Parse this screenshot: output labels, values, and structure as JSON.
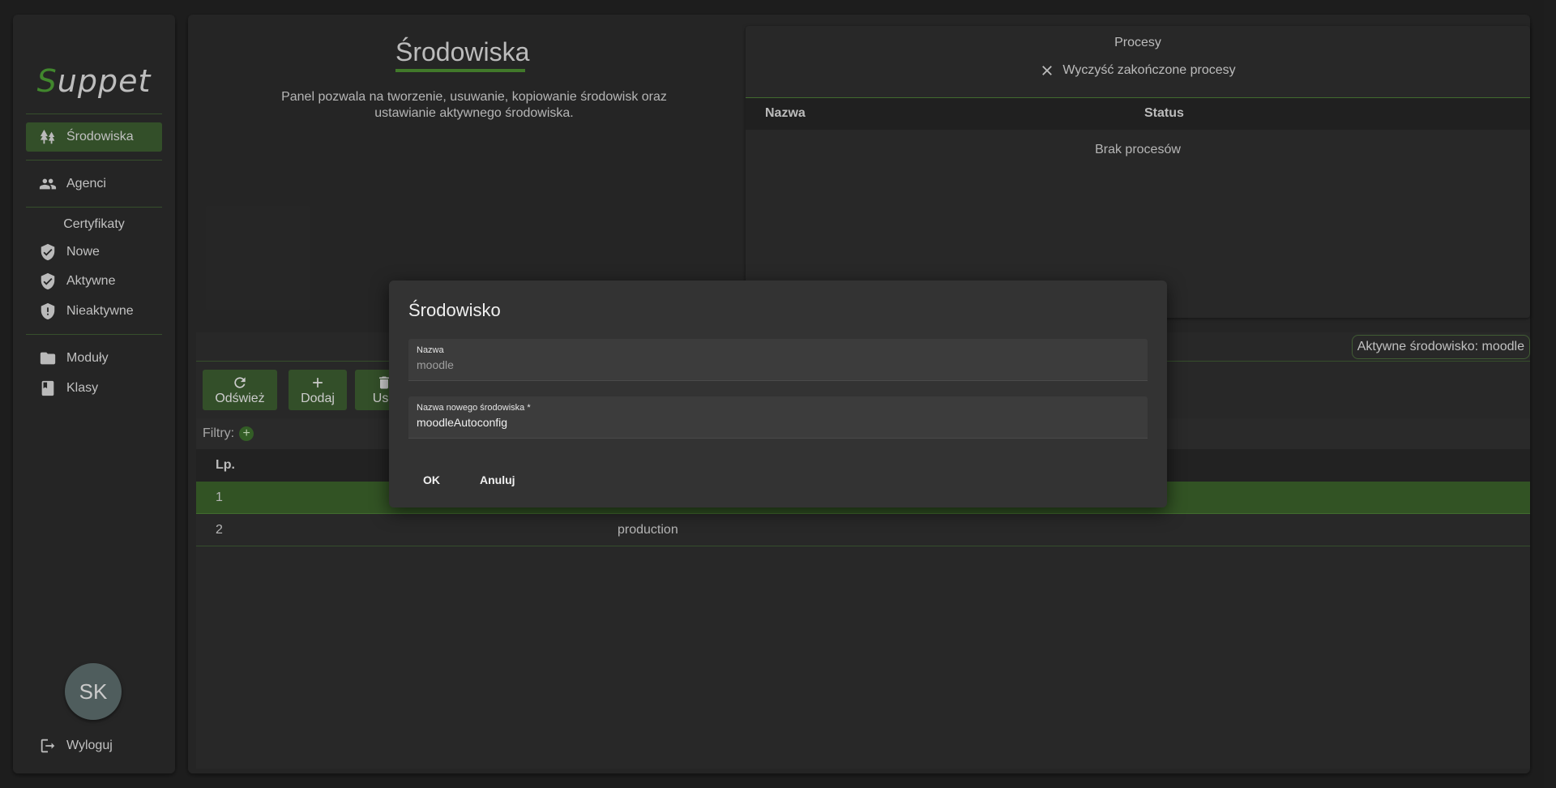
{
  "app": {
    "logo_first": "S",
    "logo_rest": "uppet"
  },
  "sidebar": {
    "items": [
      {
        "label": "Środowiska",
        "icon": "trees-icon",
        "active": true
      },
      {
        "label": "Agenci",
        "icon": "people-icon",
        "active": false
      }
    ],
    "cert_section_label": "Certyfikaty",
    "cert_items": [
      {
        "label": "Nowe",
        "icon": "shield-check-icon"
      },
      {
        "label": "Aktywne",
        "icon": "shield-check-icon"
      },
      {
        "label": "Nieaktywne",
        "icon": "shield-alert-icon"
      }
    ],
    "misc_items": [
      {
        "label": "Moduły",
        "icon": "folder-icon"
      },
      {
        "label": "Klasy",
        "icon": "book-icon"
      }
    ],
    "avatar_initials": "SK",
    "logout_label": "Wyloguj"
  },
  "page": {
    "title": "Środowiska",
    "description": "Panel pozwala na tworzenie, usuwanie, kopiowanie środowisk oraz ustawianie aktywnego środowiska."
  },
  "processes": {
    "title": "Procesy",
    "clear_label": "Wyczyść zakończone procesy",
    "columns": [
      "Nazwa",
      "Status"
    ],
    "empty_text": "Brak procesów"
  },
  "active_env_label": "Aktywne środowisko: moodle",
  "toolbar": {
    "refresh_label": "Odśwież",
    "add_label": "Dodaj",
    "delete_label": "Usu"
  },
  "filters_label": "Filtry:",
  "table": {
    "columns": [
      "Lp."
    ],
    "rows": [
      {
        "lp": "1",
        "name": "",
        "selected": true
      },
      {
        "lp": "2",
        "name": "production",
        "selected": false
      }
    ]
  },
  "dialog": {
    "title": "Środowisko",
    "name_label": "Nazwa",
    "name_value": "moodle",
    "new_name_label": "Nazwa nowego środowiska *",
    "new_name_value": "moodleAutoconfig",
    "ok_label": "OK",
    "cancel_label": "Anuluj"
  },
  "colors": {
    "accent": "#4b9a34",
    "active_bg": "#3b5a2f",
    "selected_row": "#3a5f2a",
    "background": "#222222",
    "card": "#2b2b2b"
  }
}
